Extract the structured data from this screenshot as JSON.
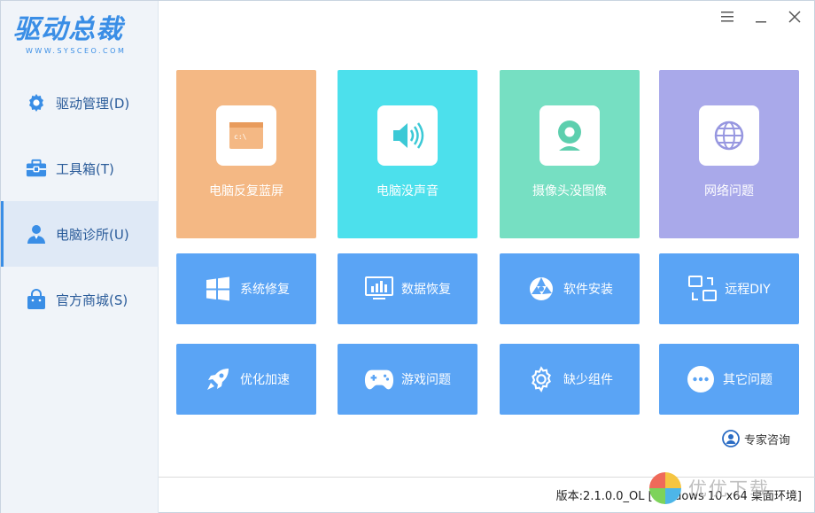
{
  "window": {
    "controls": [
      "menu",
      "minimize",
      "close"
    ]
  },
  "logo": {
    "title": "驱动总裁",
    "subtitle": "WWW.SYSCEO.COM"
  },
  "sidebar": {
    "items": [
      {
        "label": "驱动管理(D)",
        "icon": "gear-icon",
        "active": false
      },
      {
        "label": "工具箱(T)",
        "icon": "toolbox-icon",
        "active": false
      },
      {
        "label": "电脑诊所(U)",
        "icon": "doctor-icon",
        "active": true
      },
      {
        "label": "官方商城(S)",
        "icon": "shopping-bag-icon",
        "active": false
      }
    ]
  },
  "main": {
    "big_tiles": [
      {
        "label": "电脑反复蓝屏",
        "icon": "console-window-icon",
        "color": "#f4b884"
      },
      {
        "label": "电脑没声音",
        "icon": "speaker-icon",
        "color": "#4ce0ec"
      },
      {
        "label": "摄像头没图像",
        "icon": "webcam-icon",
        "color": "#76dfc2"
      },
      {
        "label": "网络问题",
        "icon": "globe-icon",
        "color": "#a9a9ea"
      }
    ],
    "small_tiles_row1": [
      {
        "label": "系统修复",
        "icon": "windows-icon"
      },
      {
        "label": "数据恢复",
        "icon": "monitor-chart-icon"
      },
      {
        "label": "软件安装",
        "icon": "aperture-icon"
      },
      {
        "label": "远程DIY",
        "icon": "remote-screens-icon"
      }
    ],
    "small_tiles_row2": [
      {
        "label": "优化加速",
        "icon": "rocket-icon"
      },
      {
        "label": "游戏问题",
        "icon": "gamepad-icon"
      },
      {
        "label": "缺少组件",
        "icon": "cog-icon"
      },
      {
        "label": "其它问题",
        "icon": "more-dots-icon"
      }
    ],
    "small_tile_color": "#5aa4f5",
    "expert_label": "专家咨询"
  },
  "status": {
    "version": "版本:2.1.0.0_OL [Windows 10 x64 桌面环境]"
  },
  "watermark": {
    "text": "优优下载"
  }
}
